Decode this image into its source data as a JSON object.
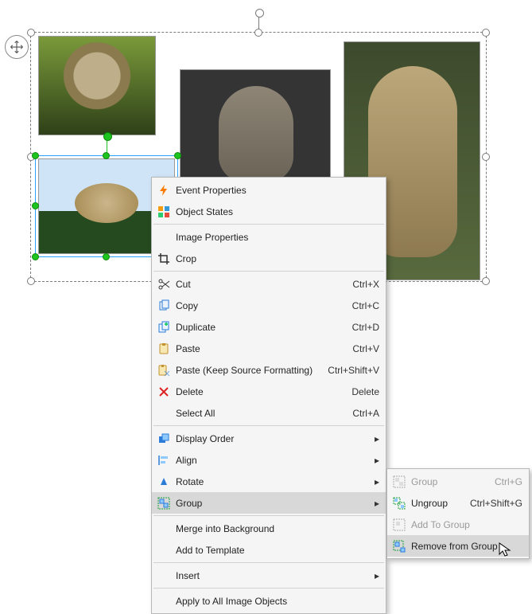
{
  "contextMenu": {
    "items": [
      {
        "label": "Event Properties"
      },
      {
        "label": "Object States"
      },
      {
        "label": "Image Properties"
      },
      {
        "label": "Crop"
      },
      {
        "label": "Cut",
        "shortcut": "Ctrl+X"
      },
      {
        "label": "Copy",
        "shortcut": "Ctrl+C"
      },
      {
        "label": "Duplicate",
        "shortcut": "Ctrl+D"
      },
      {
        "label": "Paste",
        "shortcut": "Ctrl+V"
      },
      {
        "label": "Paste (Keep Source Formatting)",
        "shortcut": "Ctrl+Shift+V"
      },
      {
        "label": "Delete",
        "shortcut": "Delete"
      },
      {
        "label": "Select All",
        "shortcut": "Ctrl+A"
      },
      {
        "label": "Display Order"
      },
      {
        "label": "Align"
      },
      {
        "label": "Rotate"
      },
      {
        "label": "Group"
      },
      {
        "label": "Merge into Background"
      },
      {
        "label": "Add to Template"
      },
      {
        "label": "Insert"
      },
      {
        "label": "Apply to All Image Objects"
      }
    ]
  },
  "submenu": {
    "items": [
      {
        "label": "Group",
        "shortcut": "Ctrl+G"
      },
      {
        "label": "Ungroup",
        "shortcut": "Ctrl+Shift+G"
      },
      {
        "label": "Add To Group"
      },
      {
        "label": "Remove from Group"
      }
    ]
  }
}
